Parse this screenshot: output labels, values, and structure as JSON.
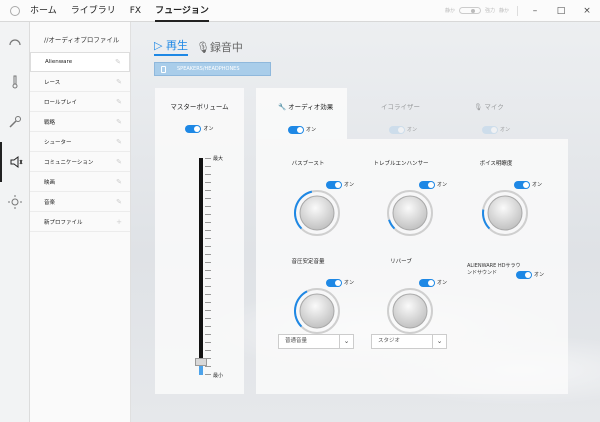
{
  "titlebar": {
    "nav": [
      "ホーム",
      "ライブラリ",
      "FX",
      "フュージョン"
    ],
    "active_nav": "フュージョン",
    "mode_low": "静か",
    "mode_high": "強力",
    "buttons": [
      "–",
      "□",
      "×"
    ]
  },
  "rail": {
    "icons": [
      "gauge-icon",
      "thermometer-icon",
      "wrench-icon",
      "speaker-icon",
      "sun-icon"
    ],
    "active": "speaker-icon"
  },
  "profiles": {
    "title": "//オーディオプロファイル",
    "items": [
      "Alienware",
      "レース",
      "ロールプレイ",
      "戦略",
      "シューター",
      "コミュニケーション",
      "映画",
      "音楽",
      "新プロファイル"
    ],
    "active": "Alienware"
  },
  "header": {
    "play_tab": "▷ 再生",
    "record_tab": "録音中",
    "device": "SPEAKERS/HEADPHONES"
  },
  "master": {
    "title": "マスターボリューム",
    "toggle_label": "オン",
    "volume": 0.06,
    "max_label": "最大",
    "min_label": "最小"
  },
  "effect_tabs": [
    {
      "label": "オーディオ効果",
      "toggle": "オン",
      "active": true
    },
    {
      "label": "イコライザー",
      "toggle": "オン",
      "active": false
    },
    {
      "label": "マイク",
      "toggle": "オン",
      "active": false
    }
  ],
  "effects": {
    "bass_boost": {
      "title": "バスブースト",
      "toggle": "オン",
      "level": 0.45
    },
    "treble": {
      "title": "トレブルエンハンサー",
      "toggle": "オン",
      "level": 0.1
    },
    "voice": {
      "title": "ボイス明瞭度",
      "toggle": "オン",
      "level": 0.2
    },
    "loudness": {
      "title": "音圧安定音量",
      "toggle": "オン",
      "level": 0.4,
      "select": "普通音量"
    },
    "reverb": {
      "title": "リバーブ",
      "toggle": "オン",
      "level": 0.0,
      "select": "スタジオ"
    },
    "hd_label": "ALIENWARE HDサラウンドサウンド",
    "hd_toggle": "オン"
  },
  "colors": {
    "accent": "#1e88e5",
    "device_bg": "#a9cdea"
  }
}
